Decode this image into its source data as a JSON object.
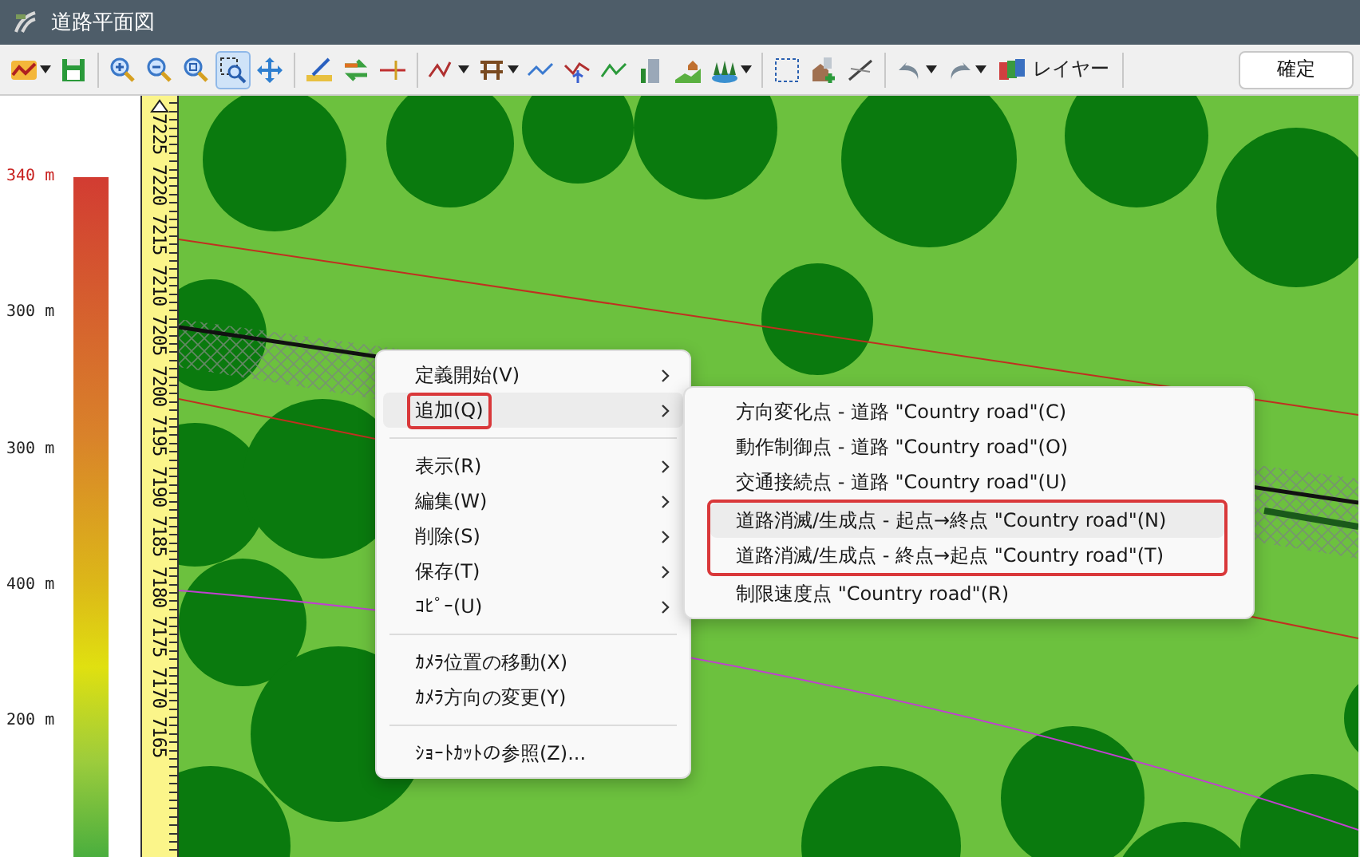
{
  "window": {
    "title": "道路平面図"
  },
  "toolbar": {
    "groups": [
      [
        {
          "dropdown": true,
          "selected": false
        },
        {
          "dropdown": false,
          "selected": false
        }
      ],
      [
        {
          "dropdown": false,
          "selected": false
        },
        {
          "dropdown": false,
          "selected": false
        },
        {
          "dropdown": false,
          "selected": false
        },
        {
          "dropdown": false,
          "selected": true
        },
        {
          "dropdown": false,
          "selected": false
        }
      ],
      [
        {
          "dropdown": false,
          "selected": false
        },
        {
          "dropdown": false,
          "selected": false
        },
        {
          "dropdown": false,
          "selected": false
        }
      ],
      [
        {
          "dropdown": true,
          "selected": false
        },
        {
          "dropdown": true,
          "selected": false
        },
        {
          "dropdown": false,
          "selected": false
        },
        {
          "dropdown": false,
          "selected": false
        },
        {
          "dropdown": false,
          "selected": false
        },
        {
          "dropdown": false,
          "selected": false
        },
        {
          "dropdown": false,
          "selected": false
        },
        {
          "dropdown": true,
          "selected": false
        }
      ],
      [
        {
          "dropdown": false,
          "selected": false
        },
        {
          "dropdown": false,
          "selected": false
        },
        {
          "dropdown": false,
          "selected": false
        }
      ],
      [
        {
          "dropdown": true,
          "selected": false
        },
        {
          "dropdown": true,
          "selected": false
        }
      ]
    ],
    "layers_label": "レイヤー",
    "confirm_label": "確定"
  },
  "legend": {
    "labels": [
      {
        "text": "340 m",
        "color": "#c8201e"
      },
      {
        "text": "300 m",
        "color": "#222222"
      },
      {
        "text": "300 m",
        "color": "#222222"
      },
      {
        "text": "400 m",
        "color": "#222222"
      },
      {
        "text": "200 m",
        "color": "#222222"
      }
    ]
  },
  "ruler": {
    "ticks": [
      "7225",
      "7220",
      "7215",
      "7210",
      "7205",
      "7200",
      "7195",
      "7190",
      "7185",
      "7180",
      "7175",
      "7170",
      "7165"
    ]
  },
  "context_menu": {
    "items": [
      {
        "kind": "item",
        "label": "定義開始(V)",
        "submenu": true,
        "selected": false,
        "outlined": false
      },
      {
        "kind": "item",
        "label": "追加(Q)",
        "submenu": true,
        "selected": true,
        "outlined": true
      },
      {
        "kind": "separator"
      },
      {
        "kind": "item",
        "label": "表示(R)",
        "submenu": true,
        "selected": false,
        "outlined": false
      },
      {
        "kind": "item",
        "label": "編集(W)",
        "submenu": true,
        "selected": false,
        "outlined": false
      },
      {
        "kind": "item",
        "label": "削除(S)",
        "submenu": true,
        "selected": false,
        "outlined": false
      },
      {
        "kind": "item",
        "label": "保存(T)",
        "submenu": true,
        "selected": false,
        "outlined": false
      },
      {
        "kind": "item",
        "label": "ｺﾋﾟｰ(U)",
        "submenu": true,
        "selected": false,
        "outlined": false
      },
      {
        "kind": "separator"
      },
      {
        "kind": "item",
        "label": "ｶﾒﾗ位置の移動(X)",
        "submenu": false,
        "selected": false,
        "outlined": false
      },
      {
        "kind": "item",
        "label": "ｶﾒﾗ方向の変更(Y)",
        "submenu": false,
        "selected": false,
        "outlined": false
      },
      {
        "kind": "separator"
      },
      {
        "kind": "item",
        "label": "ｼｮｰﾄｶｯﾄの参照(Z)...",
        "submenu": false,
        "selected": false,
        "outlined": false
      }
    ]
  },
  "submenu": {
    "items": [
      {
        "label": "方向変化点 - 道路 \"Country road\"(C)",
        "selected": false,
        "outlined": false
      },
      {
        "label": "動作制御点 - 道路 \"Country road\"(O)",
        "selected": false,
        "outlined": false
      },
      {
        "label": "交通接続点 - 道路 \"Country road\"(U)",
        "selected": false,
        "outlined": false
      },
      {
        "label": "道路消滅/生成点 - 起点→終点 \"Country road\"(N)",
        "selected": true,
        "outlined": true
      },
      {
        "label": "道路消滅/生成点 - 終点→起点 \"Country road\"(T)",
        "selected": false,
        "outlined": true
      },
      {
        "label": "制限速度点 \"Country road\"(R)",
        "selected": false,
        "outlined": false
      }
    ]
  }
}
